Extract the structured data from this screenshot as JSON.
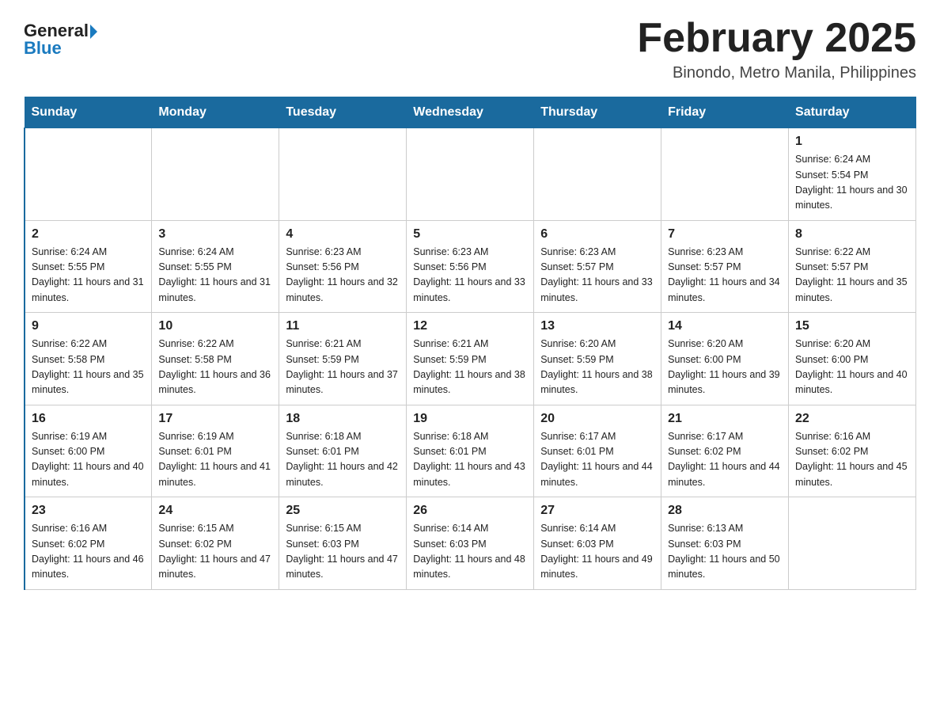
{
  "logo": {
    "general": "General",
    "blue": "Blue"
  },
  "title": "February 2025",
  "subtitle": "Binondo, Metro Manila, Philippines",
  "days_of_week": [
    "Sunday",
    "Monday",
    "Tuesday",
    "Wednesday",
    "Thursday",
    "Friday",
    "Saturday"
  ],
  "weeks": [
    {
      "days": [
        {
          "num": "",
          "info": ""
        },
        {
          "num": "",
          "info": ""
        },
        {
          "num": "",
          "info": ""
        },
        {
          "num": "",
          "info": ""
        },
        {
          "num": "",
          "info": ""
        },
        {
          "num": "",
          "info": ""
        },
        {
          "num": "1",
          "info": "Sunrise: 6:24 AM\nSunset: 5:54 PM\nDaylight: 11 hours and 30 minutes."
        }
      ]
    },
    {
      "days": [
        {
          "num": "2",
          "info": "Sunrise: 6:24 AM\nSunset: 5:55 PM\nDaylight: 11 hours and 31 minutes."
        },
        {
          "num": "3",
          "info": "Sunrise: 6:24 AM\nSunset: 5:55 PM\nDaylight: 11 hours and 31 minutes."
        },
        {
          "num": "4",
          "info": "Sunrise: 6:23 AM\nSunset: 5:56 PM\nDaylight: 11 hours and 32 minutes."
        },
        {
          "num": "5",
          "info": "Sunrise: 6:23 AM\nSunset: 5:56 PM\nDaylight: 11 hours and 33 minutes."
        },
        {
          "num": "6",
          "info": "Sunrise: 6:23 AM\nSunset: 5:57 PM\nDaylight: 11 hours and 33 minutes."
        },
        {
          "num": "7",
          "info": "Sunrise: 6:23 AM\nSunset: 5:57 PM\nDaylight: 11 hours and 34 minutes."
        },
        {
          "num": "8",
          "info": "Sunrise: 6:22 AM\nSunset: 5:57 PM\nDaylight: 11 hours and 35 minutes."
        }
      ]
    },
    {
      "days": [
        {
          "num": "9",
          "info": "Sunrise: 6:22 AM\nSunset: 5:58 PM\nDaylight: 11 hours and 35 minutes."
        },
        {
          "num": "10",
          "info": "Sunrise: 6:22 AM\nSunset: 5:58 PM\nDaylight: 11 hours and 36 minutes."
        },
        {
          "num": "11",
          "info": "Sunrise: 6:21 AM\nSunset: 5:59 PM\nDaylight: 11 hours and 37 minutes."
        },
        {
          "num": "12",
          "info": "Sunrise: 6:21 AM\nSunset: 5:59 PM\nDaylight: 11 hours and 38 minutes."
        },
        {
          "num": "13",
          "info": "Sunrise: 6:20 AM\nSunset: 5:59 PM\nDaylight: 11 hours and 38 minutes."
        },
        {
          "num": "14",
          "info": "Sunrise: 6:20 AM\nSunset: 6:00 PM\nDaylight: 11 hours and 39 minutes."
        },
        {
          "num": "15",
          "info": "Sunrise: 6:20 AM\nSunset: 6:00 PM\nDaylight: 11 hours and 40 minutes."
        }
      ]
    },
    {
      "days": [
        {
          "num": "16",
          "info": "Sunrise: 6:19 AM\nSunset: 6:00 PM\nDaylight: 11 hours and 40 minutes."
        },
        {
          "num": "17",
          "info": "Sunrise: 6:19 AM\nSunset: 6:01 PM\nDaylight: 11 hours and 41 minutes."
        },
        {
          "num": "18",
          "info": "Sunrise: 6:18 AM\nSunset: 6:01 PM\nDaylight: 11 hours and 42 minutes."
        },
        {
          "num": "19",
          "info": "Sunrise: 6:18 AM\nSunset: 6:01 PM\nDaylight: 11 hours and 43 minutes."
        },
        {
          "num": "20",
          "info": "Sunrise: 6:17 AM\nSunset: 6:01 PM\nDaylight: 11 hours and 44 minutes."
        },
        {
          "num": "21",
          "info": "Sunrise: 6:17 AM\nSunset: 6:02 PM\nDaylight: 11 hours and 44 minutes."
        },
        {
          "num": "22",
          "info": "Sunrise: 6:16 AM\nSunset: 6:02 PM\nDaylight: 11 hours and 45 minutes."
        }
      ]
    },
    {
      "days": [
        {
          "num": "23",
          "info": "Sunrise: 6:16 AM\nSunset: 6:02 PM\nDaylight: 11 hours and 46 minutes."
        },
        {
          "num": "24",
          "info": "Sunrise: 6:15 AM\nSunset: 6:02 PM\nDaylight: 11 hours and 47 minutes."
        },
        {
          "num": "25",
          "info": "Sunrise: 6:15 AM\nSunset: 6:03 PM\nDaylight: 11 hours and 47 minutes."
        },
        {
          "num": "26",
          "info": "Sunrise: 6:14 AM\nSunset: 6:03 PM\nDaylight: 11 hours and 48 minutes."
        },
        {
          "num": "27",
          "info": "Sunrise: 6:14 AM\nSunset: 6:03 PM\nDaylight: 11 hours and 49 minutes."
        },
        {
          "num": "28",
          "info": "Sunrise: 6:13 AM\nSunset: 6:03 PM\nDaylight: 11 hours and 50 minutes."
        },
        {
          "num": "",
          "info": ""
        }
      ]
    }
  ]
}
